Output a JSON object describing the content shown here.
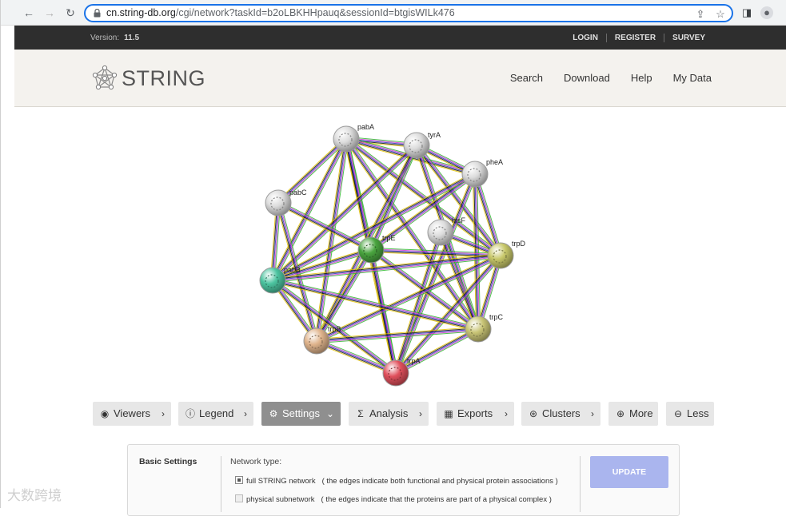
{
  "browser": {
    "url_host": "cn.string-db.org",
    "url_path": "/cgi/network?taskId=b2oLBKHHpauq&sessionId=btgisWILk476"
  },
  "topbar": {
    "version_label": "Version:",
    "version_value": "11.5",
    "links": [
      "LOGIN",
      "REGISTER",
      "SURVEY"
    ]
  },
  "header": {
    "logo_text": "STRING",
    "nav": [
      "Search",
      "Download",
      "Help",
      "My Data"
    ]
  },
  "network": {
    "nodes": [
      {
        "id": "pabA",
        "label": "pabA",
        "color": "#dcdcdc"
      },
      {
        "id": "tyrA",
        "label": "tyrA",
        "color": "#dcdcdc"
      },
      {
        "id": "pheA",
        "label": "pheA",
        "color": "#dcdcdc"
      },
      {
        "id": "pabC",
        "label": "pabC",
        "color": "#dcdcdc"
      },
      {
        "id": "hisF",
        "label": "hisF",
        "color": "#dcdcdc"
      },
      {
        "id": "trpE",
        "label": "trpE",
        "color": "#4aa53f"
      },
      {
        "id": "trpD",
        "label": "trpD",
        "color": "#c8c86a"
      },
      {
        "id": "pabB",
        "label": "pabB",
        "color": "#4cc4a0"
      },
      {
        "id": "trpC",
        "label": "trpC",
        "color": "#c9c576"
      },
      {
        "id": "trpB",
        "label": "trpB",
        "color": "#e0b48c"
      },
      {
        "id": "trpA",
        "label": "trpA",
        "color": "#e0505c"
      }
    ],
    "edges": [
      [
        "pabA",
        "tyrA"
      ],
      [
        "pabA",
        "pheA"
      ],
      [
        "pabA",
        "pabC"
      ],
      [
        "pabA",
        "trpE"
      ],
      [
        "pabA",
        "pabB"
      ],
      [
        "pabA",
        "trpD"
      ],
      [
        "pabA",
        "trpC"
      ],
      [
        "pabA",
        "trpB"
      ],
      [
        "pabA",
        "trpA"
      ],
      [
        "tyrA",
        "pheA"
      ],
      [
        "tyrA",
        "trpE"
      ],
      [
        "tyrA",
        "trpD"
      ],
      [
        "tyrA",
        "pabB"
      ],
      [
        "tyrA",
        "trpC"
      ],
      [
        "tyrA",
        "trpB"
      ],
      [
        "pheA",
        "trpE"
      ],
      [
        "pheA",
        "trpD"
      ],
      [
        "pheA",
        "pabB"
      ],
      [
        "pheA",
        "trpC"
      ],
      [
        "pheA",
        "trpA"
      ],
      [
        "pabC",
        "pabB"
      ],
      [
        "pabC",
        "trpE"
      ],
      [
        "pabC",
        "trpB"
      ],
      [
        "hisF",
        "trpD"
      ],
      [
        "hisF",
        "trpC"
      ],
      [
        "hisF",
        "trpA"
      ],
      [
        "trpE",
        "trpD"
      ],
      [
        "trpE",
        "pabB"
      ],
      [
        "trpE",
        "trpC"
      ],
      [
        "trpE",
        "trpB"
      ],
      [
        "trpE",
        "trpA"
      ],
      [
        "trpD",
        "pabB"
      ],
      [
        "trpD",
        "trpC"
      ],
      [
        "trpD",
        "trpB"
      ],
      [
        "trpD",
        "trpA"
      ],
      [
        "pabB",
        "trpC"
      ],
      [
        "pabB",
        "trpB"
      ],
      [
        "pabB",
        "trpA"
      ],
      [
        "trpC",
        "trpB"
      ],
      [
        "trpC",
        "trpA"
      ],
      [
        "trpB",
        "trpA"
      ]
    ],
    "edge_colors": [
      "#2fb52f",
      "#d03cd0",
      "#3030c0",
      "#101010",
      "#e0c000"
    ]
  },
  "toolbar": {
    "buttons": [
      {
        "label": "Viewers",
        "icon": "eye-icon",
        "glyph": "◉",
        "active": false,
        "chevron": "›"
      },
      {
        "label": "Legend",
        "icon": "info-icon",
        "glyph": "ⓘ",
        "active": false,
        "chevron": "›"
      },
      {
        "label": "Settings",
        "icon": "gear-icon",
        "glyph": "⚙",
        "active": true,
        "chevron": "⌄"
      },
      {
        "label": "Analysis",
        "icon": "sigma-icon",
        "glyph": "Σ",
        "active": false,
        "chevron": "›"
      },
      {
        "label": "Exports",
        "icon": "table-icon",
        "glyph": "▦",
        "active": false,
        "chevron": "›"
      },
      {
        "label": "Clusters",
        "icon": "clusters-icon",
        "glyph": "⊛",
        "active": false,
        "chevron": "›"
      },
      {
        "label": "More",
        "icon": "plus-circle-icon",
        "glyph": "⊕",
        "active": false,
        "chevron": ""
      },
      {
        "label": "Less",
        "icon": "minus-circle-icon",
        "glyph": "⊖",
        "active": false,
        "chevron": ""
      }
    ]
  },
  "settings": {
    "section_title": "Basic Settings",
    "network_type_label": "Network type:",
    "options": [
      {
        "label": "full STRING network",
        "note": "( the edges indicate both functional and physical protein associations )",
        "checked": true
      },
      {
        "label": "physical subnetwork",
        "note": "( the edges indicate that the proteins are part of a physical complex )",
        "checked": false
      }
    ],
    "update_label": "UPDATE"
  },
  "watermark": "大数跨境"
}
